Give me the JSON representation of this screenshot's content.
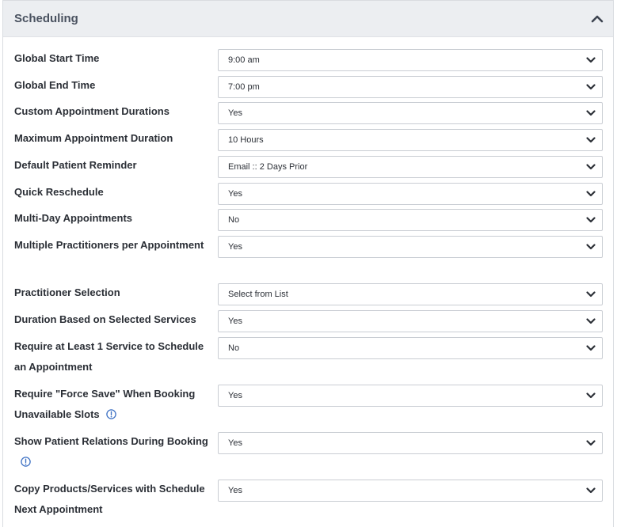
{
  "panel": {
    "title": "Scheduling"
  },
  "settings": [
    {
      "label": "Global Start Time",
      "value": "9:00 am",
      "info": false
    },
    {
      "label": "Global End Time",
      "value": "7:00 pm",
      "info": false
    },
    {
      "label": "Custom Appointment Durations",
      "value": "Yes",
      "info": false
    },
    {
      "label": "Maximum Appointment Duration",
      "value": "10 Hours",
      "info": false
    },
    {
      "label": "Default Patient Reminder",
      "value": "Email :: 2 Days Prior",
      "info": false
    },
    {
      "label": "Quick Reschedule",
      "value": "Yes",
      "info": false
    },
    {
      "label": "Multi-Day Appointments",
      "value": "No",
      "info": false
    },
    {
      "label": "Multiple Practitioners per Appointment",
      "value": "Yes",
      "info": false
    },
    {
      "label": "Practitioner Selection",
      "value": "Select from List",
      "info": false
    },
    {
      "label": "Duration Based on Selected Services",
      "value": "Yes",
      "info": false
    },
    {
      "label": "Require at Least 1 Service to Schedule an Appointment",
      "value": "No",
      "info": false
    },
    {
      "label": "Require \"Force Save\" When Booking Unavailable Slots",
      "value": "Yes",
      "info": true
    },
    {
      "label": "Show Patient Relations During Booking",
      "value": "Yes",
      "info": true
    },
    {
      "label": "Copy Products/Services with Schedule Next Appointment",
      "value": "Yes",
      "info": false
    }
  ]
}
